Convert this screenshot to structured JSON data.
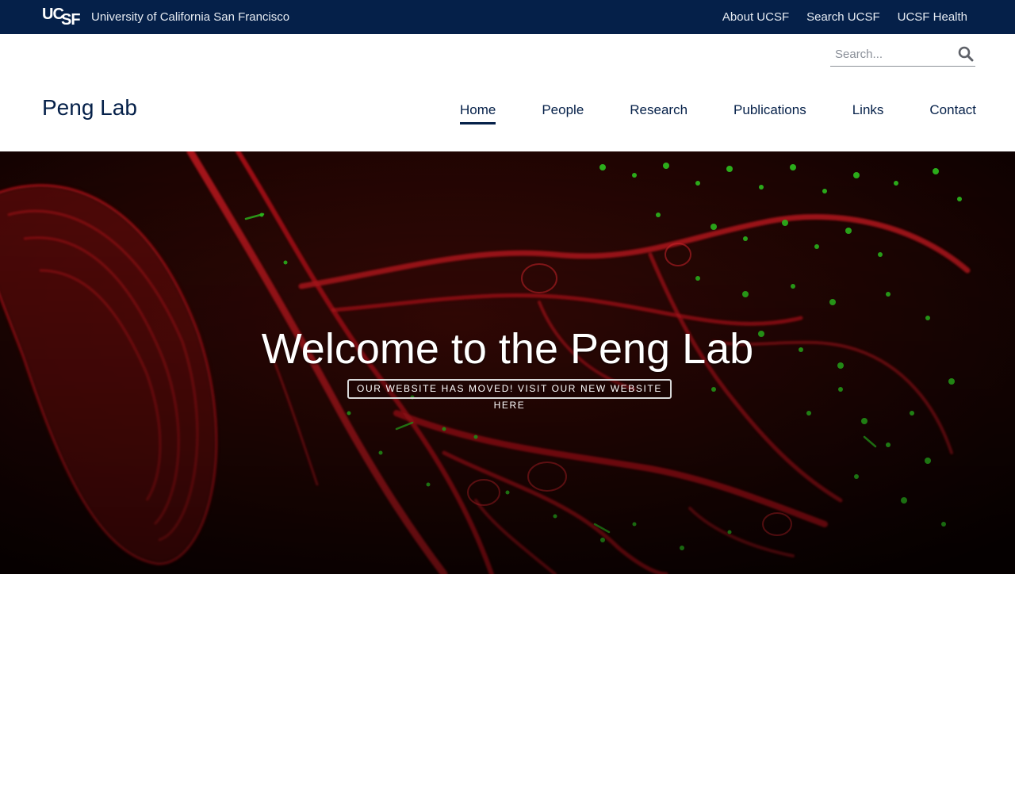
{
  "topbar": {
    "logo_text_top": "UC",
    "logo_text_bottom": "SF",
    "university_name": "University of California San Francisco",
    "links": [
      {
        "label": "About UCSF"
      },
      {
        "label": "Search UCSF"
      },
      {
        "label": "UCSF Health"
      }
    ]
  },
  "search": {
    "placeholder": "Search...",
    "value": ""
  },
  "site": {
    "title": "Peng Lab"
  },
  "nav": {
    "items": [
      {
        "label": "Home",
        "active": true
      },
      {
        "label": "People"
      },
      {
        "label": "Research"
      },
      {
        "label": "Publications"
      },
      {
        "label": "Links"
      },
      {
        "label": "Contact"
      }
    ]
  },
  "hero": {
    "title": "Welcome to the Peng Lab",
    "button_label": "OUR WEBSITE HAS MOVED! VISIT OUR NEW WEBSITE HERE"
  },
  "colors": {
    "brand_navy": "#052049",
    "hero_red": "#c0141c",
    "hero_green": "#2fc41f"
  },
  "icons": {
    "search": "search-icon",
    "logo": "ucsf-logo"
  }
}
